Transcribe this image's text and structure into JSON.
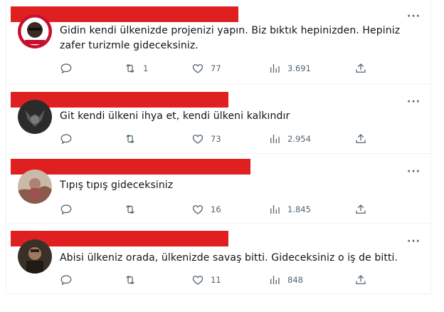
{
  "tweets": [
    {
      "text": "Gidin kendi ülkenizde projenizi yapın. Biz bıktık hepinizden. Hepiniz zafer turizmle gideceksiniz.",
      "replies": "",
      "retweets": "1",
      "likes": "77",
      "views": "3.691"
    },
    {
      "text": "Git kendi ülkeni ihya et, kendi ülkeni kalkındır",
      "replies": "",
      "retweets": "",
      "likes": "73",
      "views": "2.954"
    },
    {
      "text": "Tıpış tıpış gideceksiniz",
      "replies": "",
      "retweets": "",
      "likes": "16",
      "views": "1.845"
    },
    {
      "text": "Abisi ülkeniz orada, ülkenizde savaş bitti. Gideceksiniz o iş de bitti.",
      "replies": "",
      "retweets": "",
      "likes": "11",
      "views": "848"
    }
  ],
  "icons": {
    "more": "more-options-icon",
    "reply": "reply-icon",
    "retweet": "retweet-icon",
    "like": "heart-icon",
    "views": "views-icon",
    "share": "share-icon"
  },
  "colors": {
    "redaction": "#e02020",
    "icon_gray": "#536471",
    "text": "#0f1419",
    "divider": "#eff3f4"
  },
  "more_label": "···"
}
